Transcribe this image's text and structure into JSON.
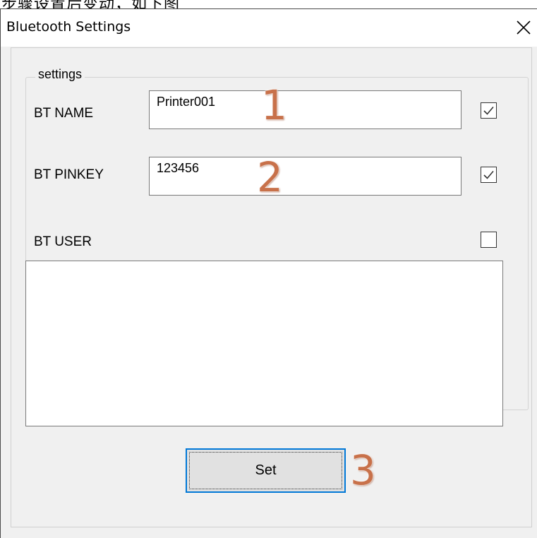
{
  "caption_fragment": "步骤设置后变动，如下图",
  "window": {
    "title": "Bluetooth Settings",
    "close_icon": "close-icon"
  },
  "group": {
    "legend": "settings"
  },
  "fields": {
    "bt_name": {
      "label": "BT NAME",
      "value": "Printer001",
      "checked": true
    },
    "bt_pinkey": {
      "label": "BT PINKEY",
      "value": "123456",
      "checked": true
    },
    "bt_user": {
      "label": "BT USER",
      "value": "",
      "checked": false
    }
  },
  "buttons": {
    "set_label": "Set"
  },
  "annotations": {
    "one": "1",
    "two": "2",
    "three": "3"
  },
  "colors": {
    "accent": "#0078d7",
    "annotation": "#c8714a",
    "client_bg": "#f0f0f0"
  }
}
